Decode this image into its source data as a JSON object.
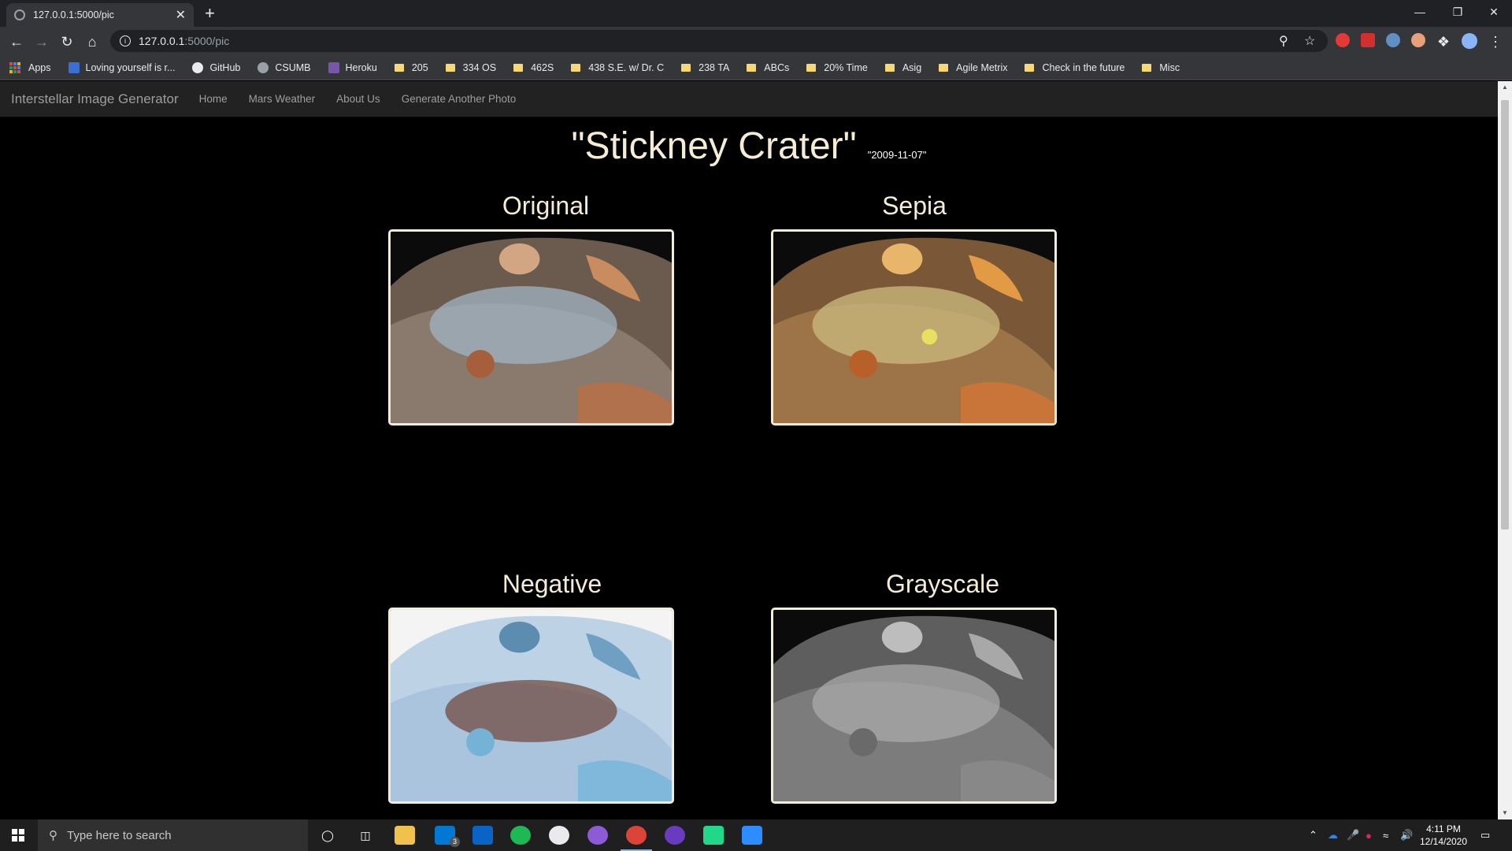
{
  "browser": {
    "tab_title": "127.0.0.1:5000/pic",
    "url_host": "127.0.0.1",
    "url_path": ":5000/pic",
    "bookmarks": [
      {
        "label": "Apps",
        "icon": "apps-grid-icon"
      },
      {
        "label": "Loving yourself is r...",
        "icon": "jc-icon"
      },
      {
        "label": "GitHub",
        "icon": "github-icon"
      },
      {
        "label": "CSUMB",
        "icon": "csumb-icon"
      },
      {
        "label": "Heroku",
        "icon": "heroku-icon"
      },
      {
        "label": "205",
        "icon": "folder-icon"
      },
      {
        "label": "334 OS",
        "icon": "folder-icon"
      },
      {
        "label": "462S",
        "icon": "folder-icon"
      },
      {
        "label": "438 S.E. w/ Dr. C",
        "icon": "folder-icon"
      },
      {
        "label": "238 TA",
        "icon": "folder-icon"
      },
      {
        "label": "ABCs",
        "icon": "folder-icon"
      },
      {
        "label": "20% Time",
        "icon": "folder-icon"
      },
      {
        "label": "Asig",
        "icon": "folder-icon"
      },
      {
        "label": "Agile Metrix",
        "icon": "folder-icon"
      },
      {
        "label": "Check in the future",
        "icon": "folder-icon"
      },
      {
        "label": "Misc",
        "icon": "folder-icon"
      }
    ]
  },
  "site": {
    "brand": "Interstellar Image Generator",
    "nav": [
      "Home",
      "Mars Weather",
      "About Us",
      "Generate Another Photo"
    ],
    "title": "\"Stickney Crater\"",
    "date": "\"2009-11-07\"",
    "panels": [
      {
        "label": "Original"
      },
      {
        "label": "Sepia"
      },
      {
        "label": "Negative"
      },
      {
        "label": "Grayscale"
      }
    ]
  },
  "taskbar": {
    "search_placeholder": "Type here to search",
    "mail_badge": "3",
    "time": "4:11 PM",
    "date": "12/14/2020"
  },
  "colors": {
    "title_text": "#f5ecd6",
    "navbar_bg": "#222222",
    "nav_link": "#9d9d9d"
  }
}
